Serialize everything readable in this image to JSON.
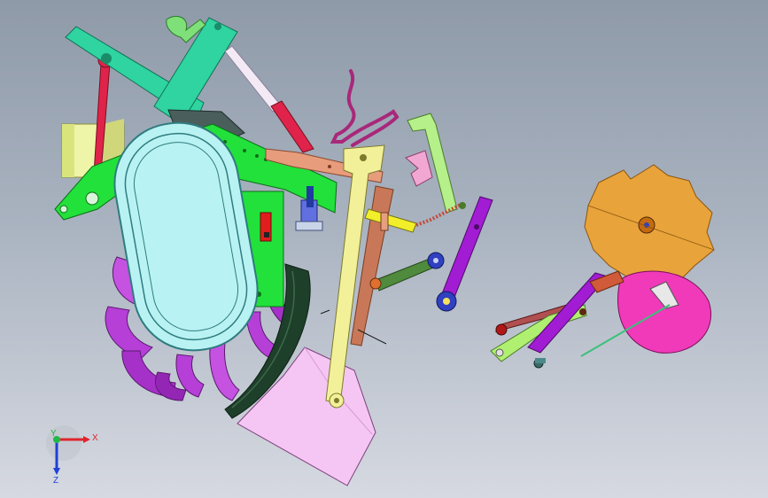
{
  "viewport": {
    "background_top": "#8f9aa9",
    "background_bottom": "#d6d9e1"
  },
  "colors": {
    "tine_purple": "#b63fd8",
    "frame_green": "#22e13a",
    "mint_arm": "#2fd4a0",
    "red_rod": "#e0234a",
    "cream_beam": "#f3f09a",
    "plow_pink": "#f5c6f3",
    "orange_disc": "#e8a33a",
    "magenta_disc": "#f03ab9",
    "salmon_bar": "#e79c7c",
    "violet_link": "#a11cd3",
    "olive_arm": "#4f8a3d",
    "cyan_guard": "#b9f2f2",
    "dark_green": "#1e3f2a"
  },
  "triad": {
    "x_label": "X",
    "y_label": "Y",
    "z_label": "Z",
    "x_color": "#e0242d",
    "y_color": "#1fb84a",
    "z_color": "#2040d8"
  }
}
